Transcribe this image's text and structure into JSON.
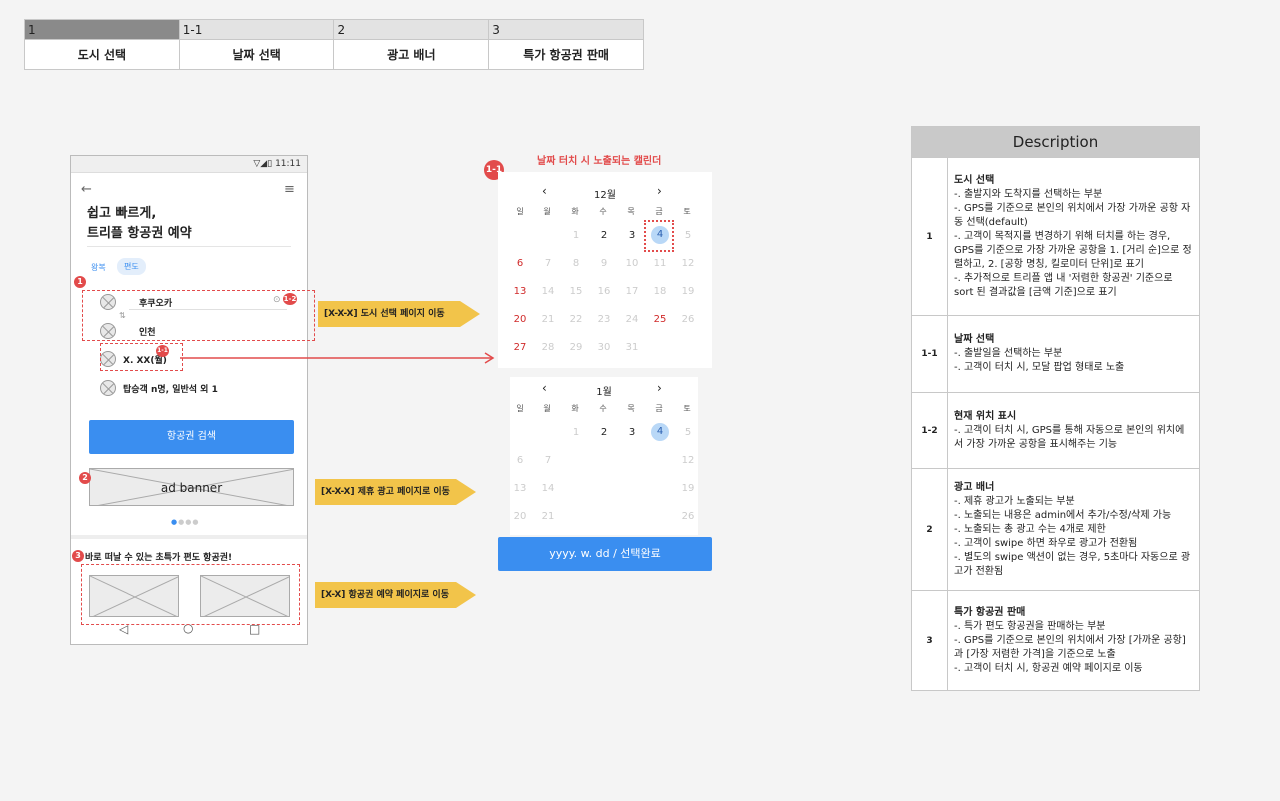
{
  "top_table": {
    "headers": [
      "1",
      "1-1",
      "2",
      "3"
    ],
    "labels": [
      "도시 선택",
      "날짜 선택",
      "광고 배너",
      "특가 항공권 판매"
    ]
  },
  "phone": {
    "time": "11:11",
    "title_line1": "쉽고 빠르게,",
    "title_line2": "트리플 항공권 예약",
    "tab_roundtrip": "왕복",
    "tab_oneway": "편도",
    "departure": "후쿠오카",
    "arrival": "인천",
    "date": "X. XX(월)",
    "passengers": "탑승객 n명, 일반석 외 1",
    "search_button": "항공권 검색",
    "ad_banner": "ad banner",
    "deals_title": "바로 떠날 수 있는 초특가 편도 항공권!"
  },
  "badges": {
    "b1": "1",
    "b1_2": "1-2",
    "b1_1": "1-1",
    "b2": "2",
    "b3": "3",
    "cal": "1-1"
  },
  "arrows": {
    "a1": "[X-X-X] 도시 선택 페이지 이동",
    "a2": "[X-X-X] 제휴 광고 페이지로 이동",
    "a3": "[X-X] 항공권 예약 페이지로 이동"
  },
  "calendar": {
    "caption": "날짜 터치 시 노출되는 캘린더",
    "month1": "12월",
    "month2": "1월",
    "prev": "‹",
    "next": "›",
    "weekdays": [
      "일",
      "월",
      "화",
      "수",
      "목",
      "금",
      "토"
    ],
    "confirm": "yyyy. w. dd / 선택완료"
  },
  "description": {
    "header": "Description",
    "rows": [
      {
        "num": "1",
        "title": "도시 선택",
        "body": "-. 출발지와 도착지를 선택하는 부분\n-. GPS를 기준으로 본인의 위치에서 가장 가까운 공항 자동 선택(default)\n-. 고객이 목적지를 변경하기 위해 터치를 하는 경우, GPS를 기준으로 가장 가까운 공항을 1. [거리 순]으로 정렬하고, 2. [공항 명칭, 킬로미터 단위]로 표기\n-. 추가적으로 트리플 앱 내 '저렴한 항공권' 기준으로 sort 된 결과값을 [금액 기준]으로 표기"
      },
      {
        "num": "1-1",
        "title": "날짜 선택",
        "body": "-. 출발일을 선택하는 부분\n-. 고객이 터치 시, 모달 팝업 형태로 노출"
      },
      {
        "num": "1-2",
        "title": "현재 위치 표시",
        "body": "-. 고객이 터치 시, GPS를 통해 자동으로 본인의 위치에서 가장 가까운 공항을 표시해주는 기능"
      },
      {
        "num": "2",
        "title": "광고 배너",
        "body": "-. 제휴 광고가 노출되는 부분\n-. 노출되는 내용은 admin에서 추가/수정/삭제 가능\n-. 노출되는 총 광고 수는 4개로 제한\n-. 고객이 swipe 하면 좌우로 광고가 전환됨\n-. 별도의 swipe 액션이 없는 경우, 5초마다 자동으로 광고가 전환됨"
      },
      {
        "num": "3",
        "title": "특가 항공권 판매",
        "body": "-. 특가 편도 항공권을 판매하는 부분\n-. GPS를 기준으로 본인의 위치에서 가장 [가까운 공항]과 [가장 저렴한 가격]을 기준으로 노출\n-. 고객이 터치 시, 항공권 예약 페이지로 이동"
      }
    ]
  },
  "colors": {
    "accent": "#3a8ef0",
    "red": "#e24b4b",
    "yellow": "#f2c44a"
  }
}
